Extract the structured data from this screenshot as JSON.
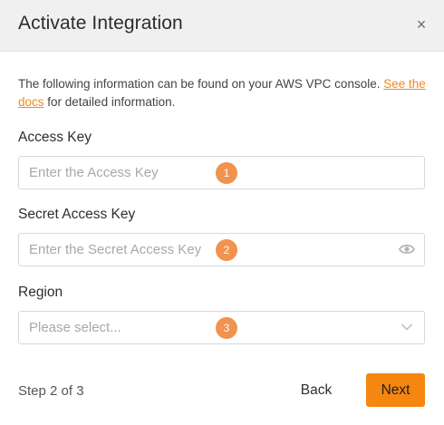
{
  "dialog": {
    "title": "Activate Integration",
    "close_label": "×"
  },
  "intro": {
    "text_before": "The following information can be found on your AWS VPC console. ",
    "link_text": "See the docs",
    "text_after": " for detailed information."
  },
  "fields": [
    {
      "label": "Access Key",
      "placeholder": "Enter the Access Key",
      "badge": "1"
    },
    {
      "label": "Secret Access Key",
      "placeholder": "Enter the Secret Access Key",
      "badge": "2",
      "icon": "eye-icon"
    },
    {
      "label": "Region",
      "placeholder": "Please select...",
      "badge": "3",
      "icon": "chevron-down-icon"
    }
  ],
  "footer": {
    "step": "Step 2 of 3",
    "back_label": "Back",
    "next_label": "Next"
  },
  "colors": {
    "accent": "#f5860f",
    "badge": "#f0934f",
    "link": "#f08a24"
  }
}
